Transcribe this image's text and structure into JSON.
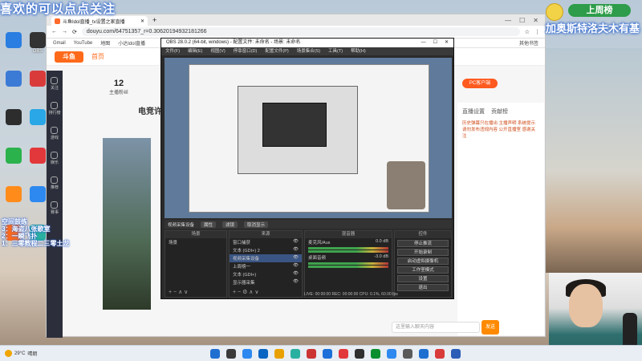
{
  "overlay": {
    "top_left_text": "喜欢的可以点点关注",
    "top_right_tag": "上周榜",
    "top_right_text": "加奥斯特洛夫木有基",
    "left_list": [
      "空间鼓练",
      "3：海盗八张歌室",
      "2：一瞬飞扑",
      "1：三零教程二三零土龙"
    ]
  },
  "desktop_icons": [
    {
      "label": "",
      "color": "#2a7de1"
    },
    {
      "label": "OBS",
      "color": "#333333"
    },
    {
      "label": "",
      "color": "#3b7bd6"
    },
    {
      "label": "",
      "color": "#d93b3b"
    },
    {
      "label": "",
      "color": "#2d2d2d"
    },
    {
      "label": "",
      "color": "#29a7e6"
    },
    {
      "label": "",
      "color": "#2bb24c"
    },
    {
      "label": "",
      "color": "#e2383b"
    },
    {
      "label": "",
      "color": "#ff8c1a"
    },
    {
      "label": "",
      "color": "#2d89ef"
    },
    {
      "label": "",
      "color": "#ff6a1a"
    },
    {
      "label": "",
      "color": "#2ab0a0"
    }
  ],
  "browser": {
    "tab_title": "斗鱼Idol直播_tv设置之家直播",
    "url": "douyu.com/64751357_r=0.30620194932181266",
    "bookmarks": [
      "Gmail",
      "YouTube",
      "地图",
      "小达Idol直播"
    ],
    "bookmarks_right": "其他书签",
    "site_logo": "斗鱼",
    "site_home": "首页",
    "rail_items": [
      "关注",
      "排行榜",
      "游戏",
      "娱乐",
      "推荐",
      "赛事"
    ],
    "follow_count": "12",
    "follow_label": "主播粉丝",
    "room_title": "电竞许游",
    "pc_button": "PC客户端",
    "right_panel_tabs": [
      "直播设置",
      "贡献榜"
    ],
    "right_panel_text": "历史弹幕只在播出 主播声明 系统提示 请勿发布违规内容 公开直播室 感谢关注",
    "chat_placeholder": "这里输入聊天内容",
    "send_label": "发送"
  },
  "obs": {
    "title": "OBS 28.0.2 (64-bit, windows) - 配置文件: 未命名 - 场景: 未命名",
    "menu": [
      "文件(F)",
      "编辑(E)",
      "视图(V)",
      "停靠窗口(D)",
      "配置文件(P)",
      "场景集合(S)",
      "工具(T)",
      "帮助(H)"
    ],
    "scene_bar_items": [
      "视频采集设备",
      "属性",
      "滤镜",
      "取消显示"
    ],
    "scenes_header": "场景",
    "scenes": [
      "场景"
    ],
    "sources_header": "来源",
    "sources": [
      "窗口捕获",
      "文本 (GDI+) 2",
      "视频采集设备",
      "上周榜一",
      "文本 (GDI+)",
      "显示器采集"
    ],
    "mixer_header": "混音器",
    "mixer_channels": [
      {
        "name": "麦克风/Aux",
        "db": "0.0 dB"
      },
      {
        "name": "桌面音频",
        "db": "-3.0 dB"
      }
    ],
    "controls_header": "控件",
    "controls": [
      "停止推流",
      "开始录制",
      "启动虚拟摄像机",
      "工作室模式",
      "设置",
      "退出"
    ],
    "status": "LIVE: 00:00:00   REC: 00:00:00   CPU: 0.1%, 60.00 fps"
  },
  "taskbar": {
    "weather_temp": "29°C",
    "weather_desc": "晴朗",
    "icon_colors": [
      "#1f6fd1",
      "#3a3a3a",
      "#2d89ef",
      "#0a64c2",
      "#e9a100",
      "#2ab0a0",
      "#cc3333",
      "#1d6fd9",
      "#e2383b",
      "#2f2f2f",
      "#0b8f2e",
      "#2d89ef",
      "#5a5a5a",
      "#1f6fd1",
      "#d93b3b",
      "#2b5fb7"
    ]
  }
}
